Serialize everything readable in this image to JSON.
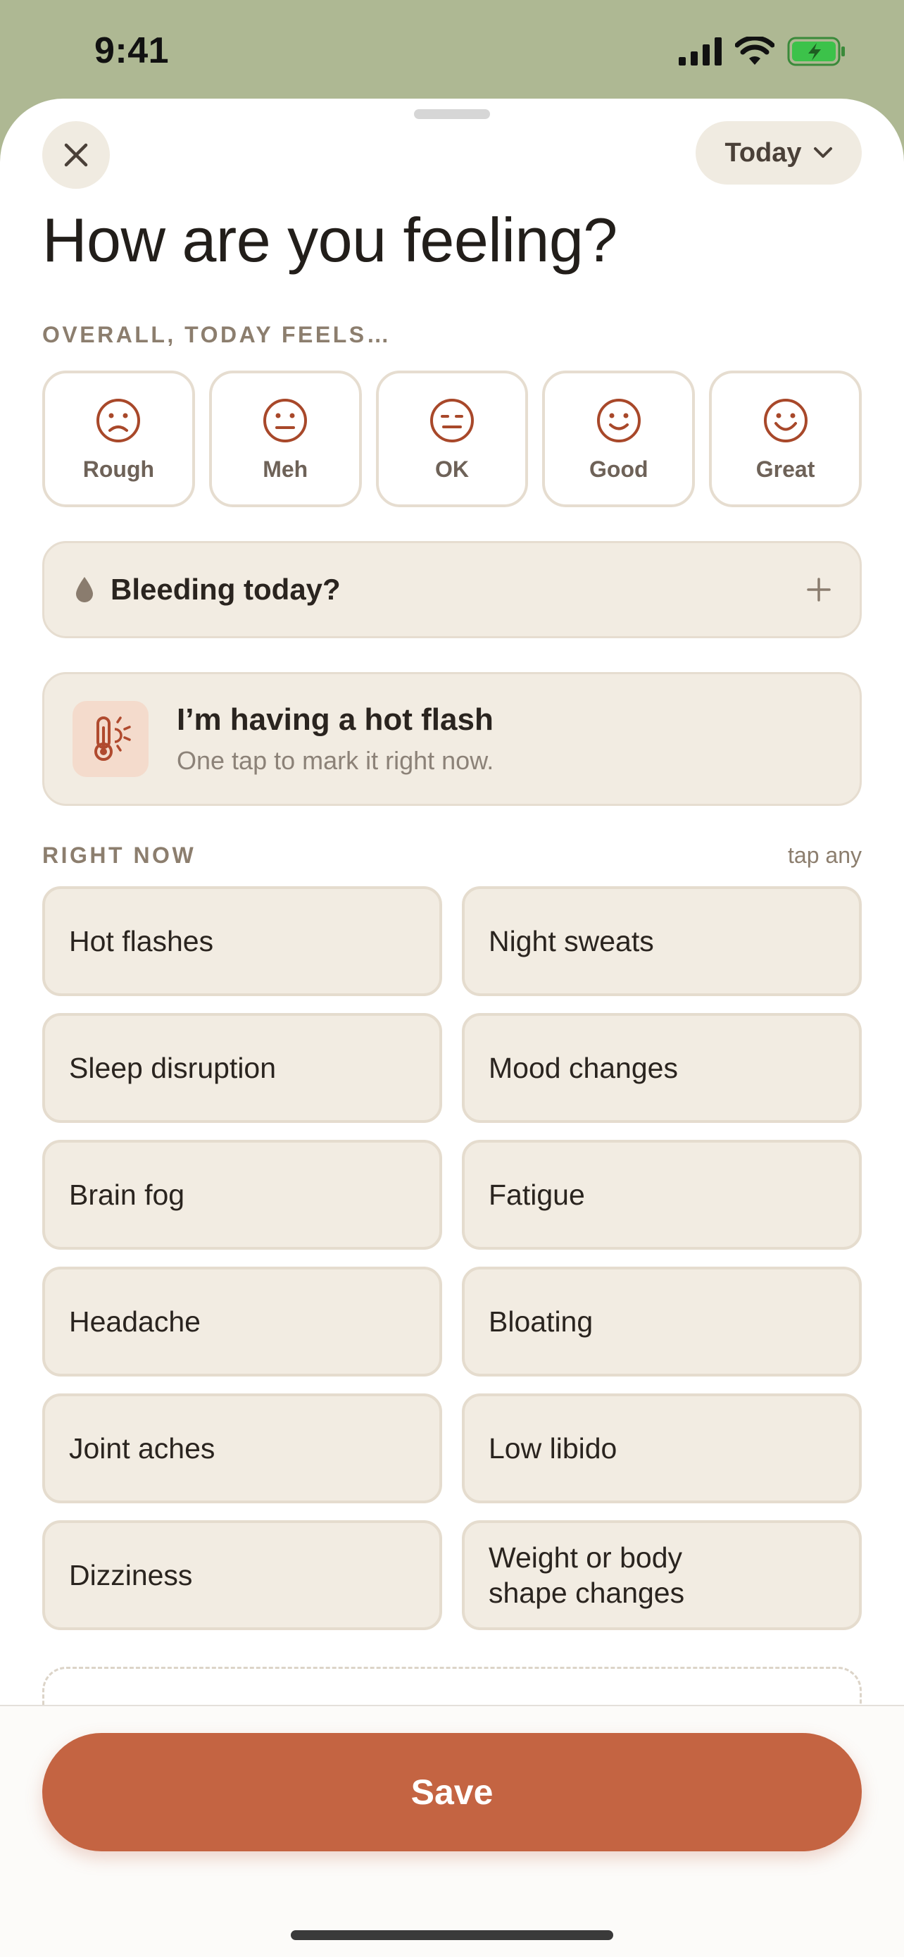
{
  "status_bar": {
    "time": "9:41"
  },
  "header": {
    "close_icon": "close-icon",
    "date_selector": "Today",
    "title": "How are you feeling?"
  },
  "overall": {
    "label": "OVERALL, TODAY FEELS…",
    "options": [
      {
        "label": "Rough",
        "icon": "frown-face-icon"
      },
      {
        "label": "Meh",
        "icon": "neutral-face-icon"
      },
      {
        "label": "OK",
        "icon": "neutral-face-icon"
      },
      {
        "label": "Good",
        "icon": "smile-face-icon"
      },
      {
        "label": "Great",
        "icon": "big-smile-face-icon"
      }
    ]
  },
  "bleeding": {
    "label": "Bleeding today?",
    "icon": "drop-icon"
  },
  "hot_flash": {
    "title": "I’m having a hot flash",
    "subtitle": "One tap to mark it right now.",
    "icon": "thermometer-sun-icon"
  },
  "right_now": {
    "label": "RIGHT NOW",
    "hint": "tap any",
    "symptoms": [
      "Hot flashes",
      "Night sweats",
      "Sleep disruption",
      "Mood changes",
      "Brain fog",
      "Fatigue",
      "Headache",
      "Bloating",
      "Joint aches",
      "Low libido",
      "Dizziness",
      "Weight or body shape changes"
    ]
  },
  "footer": {
    "save_label": "Save"
  },
  "colors": {
    "accent": "#C46442",
    "background_top": "#AEB893",
    "card": "#F2ECE2",
    "card_border": "#E5DCCE",
    "face_icon": "#A8482A"
  }
}
